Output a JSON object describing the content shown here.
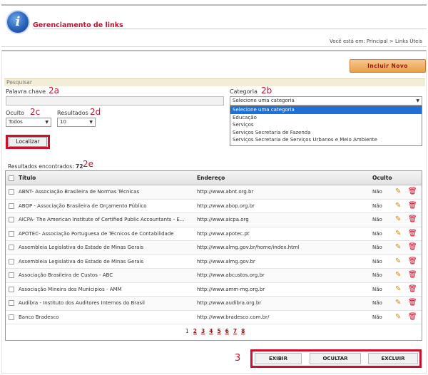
{
  "header": {
    "title": "Gerenciamento de links",
    "breadcrumb": "Você está em: Principal > Links Úteis"
  },
  "toolbar": {
    "incluir_label": "Incluir Novo"
  },
  "search": {
    "section_label": "Pesquisar",
    "palavra_label": "Palavra chave",
    "palavra_value": "",
    "categoria_label": "Categoria",
    "categoria_value": "Selecione uma categoria",
    "categoria_options": [
      "Selecione uma categoria",
      "Educação",
      "Serviços",
      "Serviços Secretaria de Fazenda",
      "Serviços Secretaria de Serviços Urbanos e Meio Ambiente"
    ],
    "oculto_label": "Oculto",
    "oculto_value": "Todos",
    "resultados_label": "Resultados",
    "resultados_value": "10",
    "localizar_label": "Localizar"
  },
  "annotations": {
    "a": "2a",
    "b": "2b",
    "c": "2c",
    "d": "2d",
    "e": "2e",
    "three": "3"
  },
  "results": {
    "label": "Resultados encontrados:",
    "count": "72"
  },
  "table": {
    "headers": {
      "titulo": "Título",
      "endereco": "Endereço",
      "oculto": "Oculto"
    },
    "rows": [
      {
        "titulo": "ABNT- Associação Brasileira de Normas Técnicas",
        "endereco": "http://www.abnt.org.br",
        "oculto": "Não"
      },
      {
        "titulo": "ABOP - Associação Brasileira de Orçamento Público",
        "endereco": "http://www.abop.org.br",
        "oculto": "Não"
      },
      {
        "titulo": "AICPA- The American Institute of Certified Public Accountants - E...",
        "endereco": "http://www.aicpa.org",
        "oculto": "Não"
      },
      {
        "titulo": "APOTEC- Associação Portuguesa de Técnicos de Contabilidade",
        "endereco": "http://www.apotec.pt",
        "oculto": "Não"
      },
      {
        "titulo": "Assembleia Legislativa do Estado de Minas Gerais",
        "endereco": "http://www.almg.gov.br/home/index.html",
        "oculto": "Não"
      },
      {
        "titulo": "Assembleia Legislativa do Estado de Minas Gerais",
        "endereco": "http://www.almg.gov.br",
        "oculto": "Não"
      },
      {
        "titulo": "Associação Brasileira de Custos - ABC",
        "endereco": "http://www.abcustos.org.br",
        "oculto": "Não"
      },
      {
        "titulo": "Associação Mineira dos Municipios - AMM",
        "endereco": "http://www.amm-mg.org.br",
        "oculto": "Não"
      },
      {
        "titulo": "Audibra - Instituto dos Auditores Internos do Brasil",
        "endereco": "http://www.audibra.org.br",
        "oculto": "Não"
      },
      {
        "titulo": "Banco Bradesco",
        "endereco": "http://www.bradesco.com.br/",
        "oculto": "Não"
      }
    ],
    "pages": [
      "1",
      "2",
      "3",
      "4",
      "5",
      "6",
      "7",
      "8"
    ]
  },
  "actions": {
    "exibir": "EXIBIR",
    "ocultar": "OCULTAR",
    "excluir": "EXCLUIR"
  },
  "icons": {
    "info": "info-icon",
    "edit": "pencil-icon",
    "delete": "trash-icon"
  },
  "colors": {
    "accent_red": "#c8102e",
    "header_blue": "#2a62b8",
    "button_orange": "#e9a04a"
  }
}
